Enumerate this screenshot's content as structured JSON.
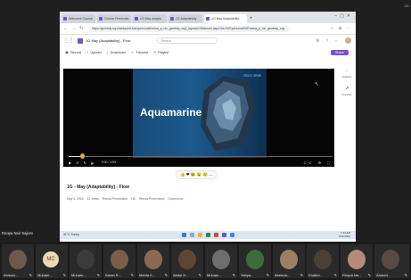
{
  "browser": {
    "tabs": [
      {
        "label": "Welcome Course"
      },
      {
        "label": "Course Fireworks"
      },
      {
        "label": "1G May adapta"
      },
      {
        "label": "1G Adaptability"
      },
      {
        "label": "1G May Adaptability"
      }
    ],
    "url": "https://gsmbdy.my.sharepoint.com/personal/reena_p_nic_gsmbdy_org/_layouts/15/stream.aspx?id=%2Fpersonal%2Freena_p_nic_gsmbdy_org"
  },
  "app": {
    "title": "1G May (Adaptability) - Flow",
    "search_placeholder": "Search",
    "toolbar": {
      "record": "Record",
      "upload": "Upload",
      "download": "Download",
      "favorite": "Favorite",
      "playlist": "Playlist",
      "share": "Share"
    }
  },
  "video": {
    "slide_title": "Aquamarine",
    "slide_logo": "ROCK GEMS",
    "timecode": "0:00 / 1:53",
    "progress": 0.05
  },
  "side_panel": {
    "item1": "Chapters",
    "item2": "Analytics"
  },
  "reactions": "👍 ❤ 😆 😮 😢 ...",
  "details": {
    "title": "1G - May (Adaptability) - Flow",
    "date": "May 4, 2024",
    "views": "12 views",
    "owner": "Reena Premchand",
    "dept": "HD",
    "owner2": "Reena Premchand",
    "folder": "Documents"
  },
  "presenter": "Roopa Nair Sajeev",
  "taskbar": {
    "weather": "31°C Sunny",
    "time": "7:14 AM",
    "date": "5/11/2024"
  },
  "participants": [
    {
      "name": "Ahmad...",
      "initials": ""
    },
    {
      "name": "Muham...",
      "initials": "MC"
    },
    {
      "name": "Muham...",
      "initials": ""
    },
    {
      "name": "Karan R...",
      "initials": ""
    },
    {
      "name": "Mehta K...",
      "initials": ""
    },
    {
      "name": "Abdul H...",
      "initials": ""
    },
    {
      "name": "Muham...",
      "initials": ""
    },
    {
      "name": "Yahya...",
      "initials": ""
    },
    {
      "name": "Abeerar...",
      "initials": ""
    },
    {
      "name": "Khaled...",
      "initials": ""
    },
    {
      "name": "Roopa Na...",
      "initials": ""
    },
    {
      "name": "Ahmed...",
      "initials": ""
    }
  ],
  "colors": {
    "accent": "#7a52c7",
    "progress_thumb": "#f2a33a"
  },
  "corner_count": "2/1"
}
